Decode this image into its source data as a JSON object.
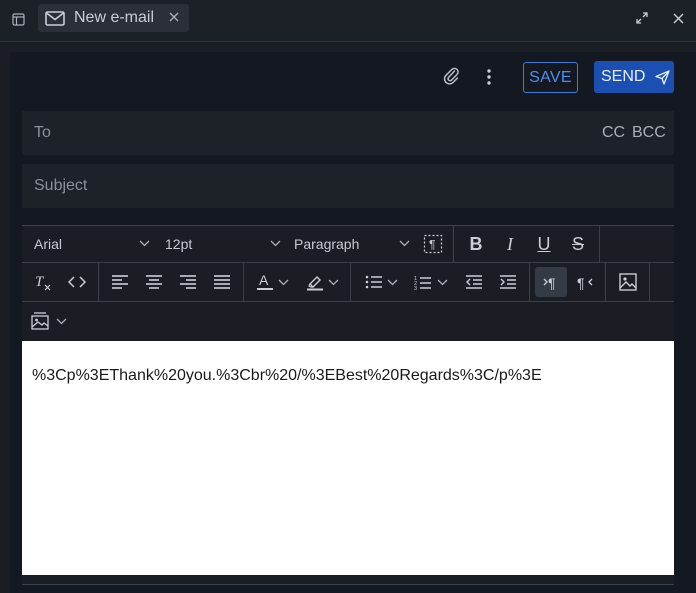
{
  "window": {
    "tab_label": "New e-mail",
    "icons": [
      "window-icon",
      "mail-icon",
      "tab-close-icon",
      "expand-icon",
      "close-icon"
    ]
  },
  "actions": {
    "save_label": "SAVE",
    "send_label": "SEND",
    "icons": [
      "paperclip-icon",
      "more-vertical-icon",
      "send-icon"
    ]
  },
  "fields": {
    "to_label": "To",
    "to_value": "",
    "cc_label": "CC",
    "bcc_label": "BCC",
    "subject_placeholder": "Subject",
    "subject_value": ""
  },
  "toolbar": {
    "font_family": "Arial",
    "font_size": "12pt",
    "block_format": "Paragraph",
    "buttons": {
      "bold": "B",
      "italic": "I",
      "underline": "U",
      "strikethrough": "S"
    }
  },
  "editor": {
    "body_text": "%3Cp%3EThank%20you.%3Cbr%20/%3EBest%20Regards%3C/p%3E"
  },
  "colors": {
    "accent": "#3d7bd6",
    "send_bg": "#1c4fb2",
    "background": "#141820",
    "field_bg": "#1d2229"
  }
}
